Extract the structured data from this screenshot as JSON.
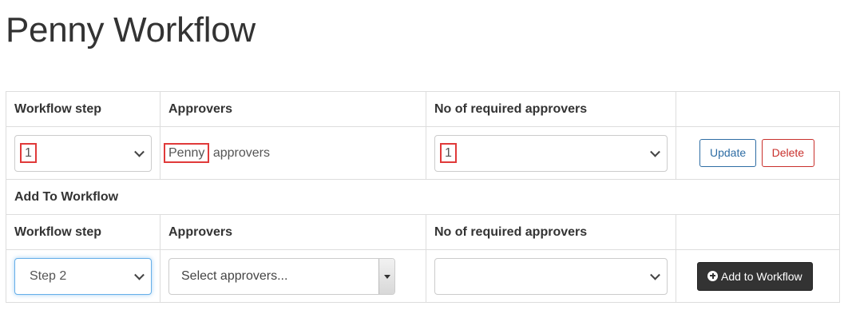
{
  "page": {
    "title": "Penny Workflow"
  },
  "table": {
    "headers": {
      "workflow_step": "Workflow step",
      "approvers": "Approvers",
      "required": "No of required approvers"
    },
    "existing_row": {
      "step_value": "1",
      "approvers_first": "Penny",
      "approvers_rest": " approvers",
      "required_value": "1",
      "update_label": "Update",
      "delete_label": "Delete"
    },
    "add_section": {
      "title": "Add To Workflow",
      "headers": {
        "workflow_step": "Workflow step",
        "approvers": "Approvers",
        "required": "No of required approvers"
      },
      "step_value": "Step 2",
      "approvers_placeholder": "Select approvers...",
      "required_value": "",
      "add_label": "Add to Workflow"
    }
  },
  "colors": {
    "highlight": "#e03a3a",
    "update": "#2e6da4",
    "delete": "#c9302c",
    "add_button_bg": "#333333",
    "focus": "#66afe9"
  },
  "icons": {
    "add": "plus-circle-icon",
    "dropdown": "chevron-down-icon"
  }
}
